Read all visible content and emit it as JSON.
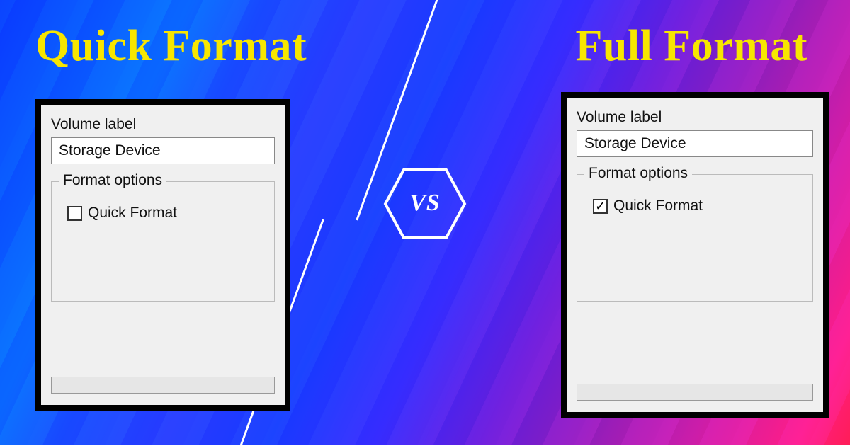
{
  "titles": {
    "left": "Quick Format",
    "right": "Full Format"
  },
  "vs": "VS",
  "left_panel": {
    "volume_label_text": "Volume label",
    "volume_value": "Storage Device",
    "format_options_text": "Format options",
    "quick_format_label": "Quick Format",
    "quick_format_checked": false
  },
  "right_panel": {
    "volume_label_text": "Volume label",
    "volume_value": "Storage Device",
    "format_options_text": "Format options",
    "quick_format_label": "Quick Format",
    "quick_format_checked": true
  }
}
